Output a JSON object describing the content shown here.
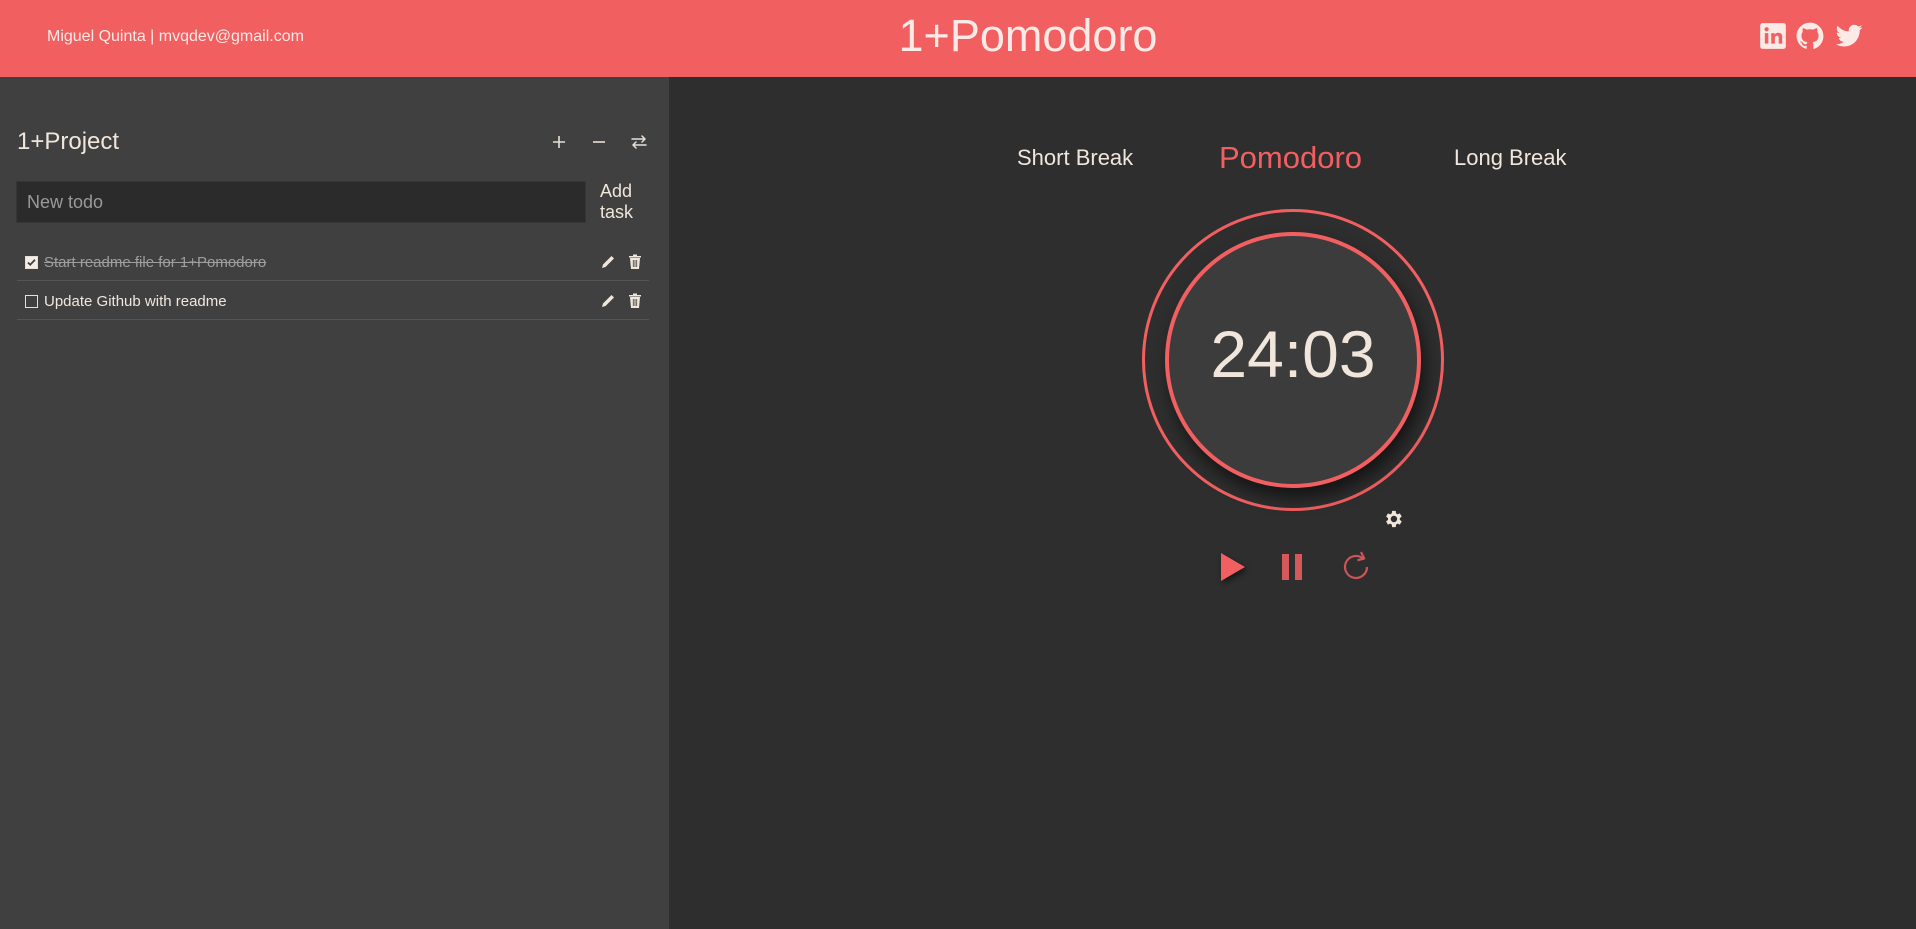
{
  "header": {
    "author": "Miguel Quinta | mvqdev@gmail.com",
    "title": "1+Pomodoro",
    "social": [
      "linkedin-icon",
      "github-icon",
      "twitter-icon"
    ]
  },
  "sidebar": {
    "project_title": "1+Project",
    "toolbar_icons": [
      "plus-icon",
      "minus-icon",
      "swap-icon"
    ],
    "new_todo_placeholder": "New todo",
    "add_label_line1": "Add",
    "add_label_line2": "task",
    "todos": [
      {
        "text": "Start readme file for 1+Pomodoro",
        "done": true
      },
      {
        "text": "Update Github with readme",
        "done": false
      }
    ]
  },
  "main": {
    "tabs": [
      {
        "label": "Short Break",
        "active": false
      },
      {
        "label": "Pomodoro",
        "active": true
      },
      {
        "label": "Long Break",
        "active": false
      }
    ],
    "time": "24:03",
    "controls": [
      "play-icon",
      "pause-icon",
      "reset-icon"
    ],
    "settings_icon": "gear-icon"
  },
  "colors": {
    "accent": "#f25f61",
    "sidebar_bg": "#404040",
    "main_bg": "#2e2e2e",
    "text": "#f0e6dc"
  }
}
